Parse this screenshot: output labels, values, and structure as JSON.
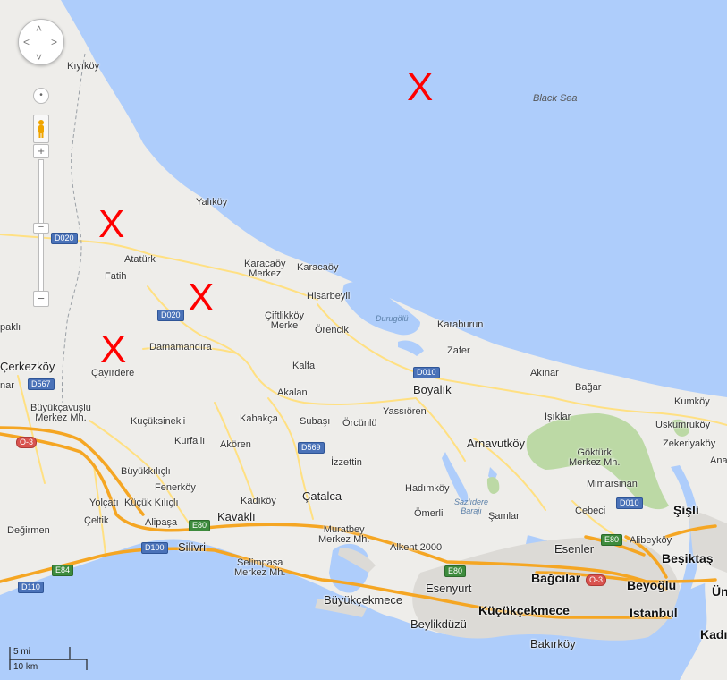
{
  "colors": {
    "water": "#aecdfb",
    "land": "#eeedea",
    "road_major": "#f5a623",
    "road_minor": "#ffe082",
    "forest": "#bcd9a5",
    "urban": "#dcdad6",
    "marker": "#ff0000"
  },
  "controls": {
    "pan_up": "˄",
    "pan_down": "˅",
    "pan_left": "˂",
    "pan_right": "˃",
    "zoom_in": "+",
    "zoom_out": "−",
    "pegman": "pegman-icon",
    "center": "•"
  },
  "markers": [
    "X",
    "X",
    "X",
    "X"
  ],
  "scale": {
    "miles": "5 mi",
    "km": "10 km"
  },
  "water_labels": {
    "black_sea": "Black Sea",
    "durugol": "Durugölü",
    "sazlidere": "Sazlıdere Barajı"
  },
  "roads": [
    "D020",
    "D020",
    "D567",
    "O-3",
    "E84",
    "D100",
    "E80",
    "D110",
    "D569",
    "D010",
    "E80",
    "O-3",
    "D010"
  ],
  "places": [
    "Kıyıköy",
    "Yalıköy",
    "Atatürk",
    "Fatih",
    "Karacaöy\nMerkez",
    "Karacaöy",
    "Hisarbeyli",
    "Çiftlikköy\nMerke",
    "Örencik",
    "Karaburun",
    "Zafer",
    "Akınar",
    "Bağar",
    "Kumköy",
    "Uskumruköy",
    "Zekeriyaköy",
    "Ana",
    "Damamandıra",
    "Çayırdere",
    "Kalfa",
    "Akalan",
    "Boyalık",
    "Yassıören",
    "Işıklar",
    "Kuçüksinekli",
    "Kabakça",
    "Subaşı",
    "Örcünlü",
    "Arnavutköy",
    "Kurfallı",
    "Akören",
    "İzzettin",
    "Göktürk\nMerkez Mh.",
    "Büyükkılıçlı",
    "Fenerköy",
    "Hadımköy",
    "Mimarsinan",
    "Kadıköy",
    "Çatalca",
    "Küçük Kılıçlı",
    "Yolçatı",
    "Çeltik",
    "Ömerli",
    "Şamlar",
    "Cebeci",
    "Kavaklı",
    "Alipaşa",
    "Şişli",
    "Değirmen",
    "Silivri",
    "Muratbey\nMerkez Mh.",
    "Esenler",
    "Alibeyköy",
    "Beşiktaş",
    "Alkent 2000",
    "Selimpaşa\nMerkez Mh.",
    "Bağcılar",
    "Beyoğlu",
    "Ün",
    "Esenyurt",
    "Büyükçekmece",
    "Küçükçekmece",
    "Istanbul",
    "Beylikdüzü",
    "Bakırköy",
    "Kadı",
    "Çerkezköy",
    "paklı",
    "nar",
    "Büyükçavuşlu\nMerkez Mh."
  ]
}
